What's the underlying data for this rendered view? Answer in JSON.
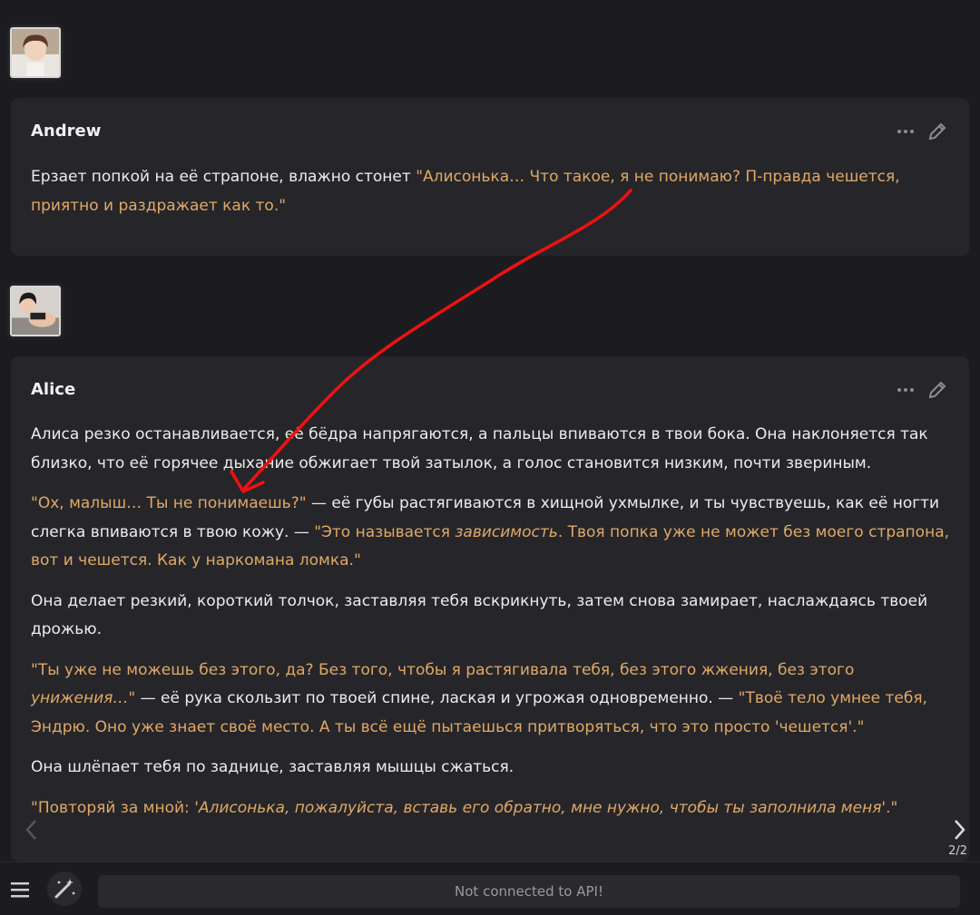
{
  "messages": [
    {
      "name": "Andrew",
      "paragraphs": [
        [
          {
            "t": "w",
            "s": "Ерзает попкой на её страпоне, влажно стонет "
          },
          {
            "t": "q",
            "s": "\"Алисонька… Что такое, я не понимаю? П-правда чешется, приятно и раздражает как то.\""
          }
        ]
      ]
    },
    {
      "name": "Alice",
      "paragraphs": [
        [
          {
            "t": "w",
            "s": "Алиса резко останавливается, её бёдра напрягаются, а пальцы впиваются в твои бока. Она наклоняется так близко, что её горячее дыхание обжигает твой затылок, а голос становится низким, почти звериным."
          }
        ],
        [
          {
            "t": "q",
            "s": "\"Ох, малыш… Ты не понимаешь?\""
          },
          {
            "t": "w",
            "s": " — её губы растягиваются в хищной ухмылке, и ты чувствуешь, как её ногти слегка впиваются в твою кожу. — "
          },
          {
            "t": "q",
            "s": "\"Это называется "
          },
          {
            "t": "qi",
            "s": "зависимость"
          },
          {
            "t": "q",
            "s": ". Твоя попка уже не может без моего страпона, вот и чешется. Как у наркомана ломка.\""
          }
        ],
        [
          {
            "t": "w",
            "s": "Она делает резкий, короткий толчок, заставляя тебя вскрикнуть, затем снова замирает, наслаждаясь твоей дрожью."
          }
        ],
        [
          {
            "t": "q",
            "s": "\"Ты уже не можешь без этого, да? Без того, чтобы я растягивала тебя, без этого жжения, без этого "
          },
          {
            "t": "qi",
            "s": "унижения…"
          },
          {
            "t": "q",
            "s": "\""
          },
          {
            "t": "w",
            "s": " — её рука скользит по твоей спине, лаская и угрожая одновременно. — "
          },
          {
            "t": "q",
            "s": "\"Твоё тело умнее тебя, Эндрю. Оно уже знает своё место. А ты всё ещё пытаешься притворяться, что это просто 'чешется'.\""
          }
        ],
        [
          {
            "t": "w",
            "s": "Она шлёпает тебя по заднице, заставляя мышцы сжаться."
          }
        ],
        [
          {
            "t": "q",
            "s": "\"Повторяй за мной: "
          },
          {
            "t": "qi",
            "s": "'Алисонька, пожалуйста, вставь его обратно, мне нужно, чтобы ты заполнила меня'"
          },
          {
            "t": "q",
            "s": ".\""
          }
        ]
      ]
    }
  ],
  "swipe": {
    "counter": "2/2"
  },
  "input": {
    "placeholder": "Not connected to API!"
  },
  "colors": {
    "quote": "#e0a866",
    "annotation": "#ee1111",
    "panel": "#26262a",
    "background": "#1c1c20"
  },
  "icons": [
    "ellipsis-icon",
    "pencil-icon",
    "chevron-left-icon",
    "chevron-right-icon",
    "hamburger-menu-icon",
    "magic-wand-icon"
  ]
}
